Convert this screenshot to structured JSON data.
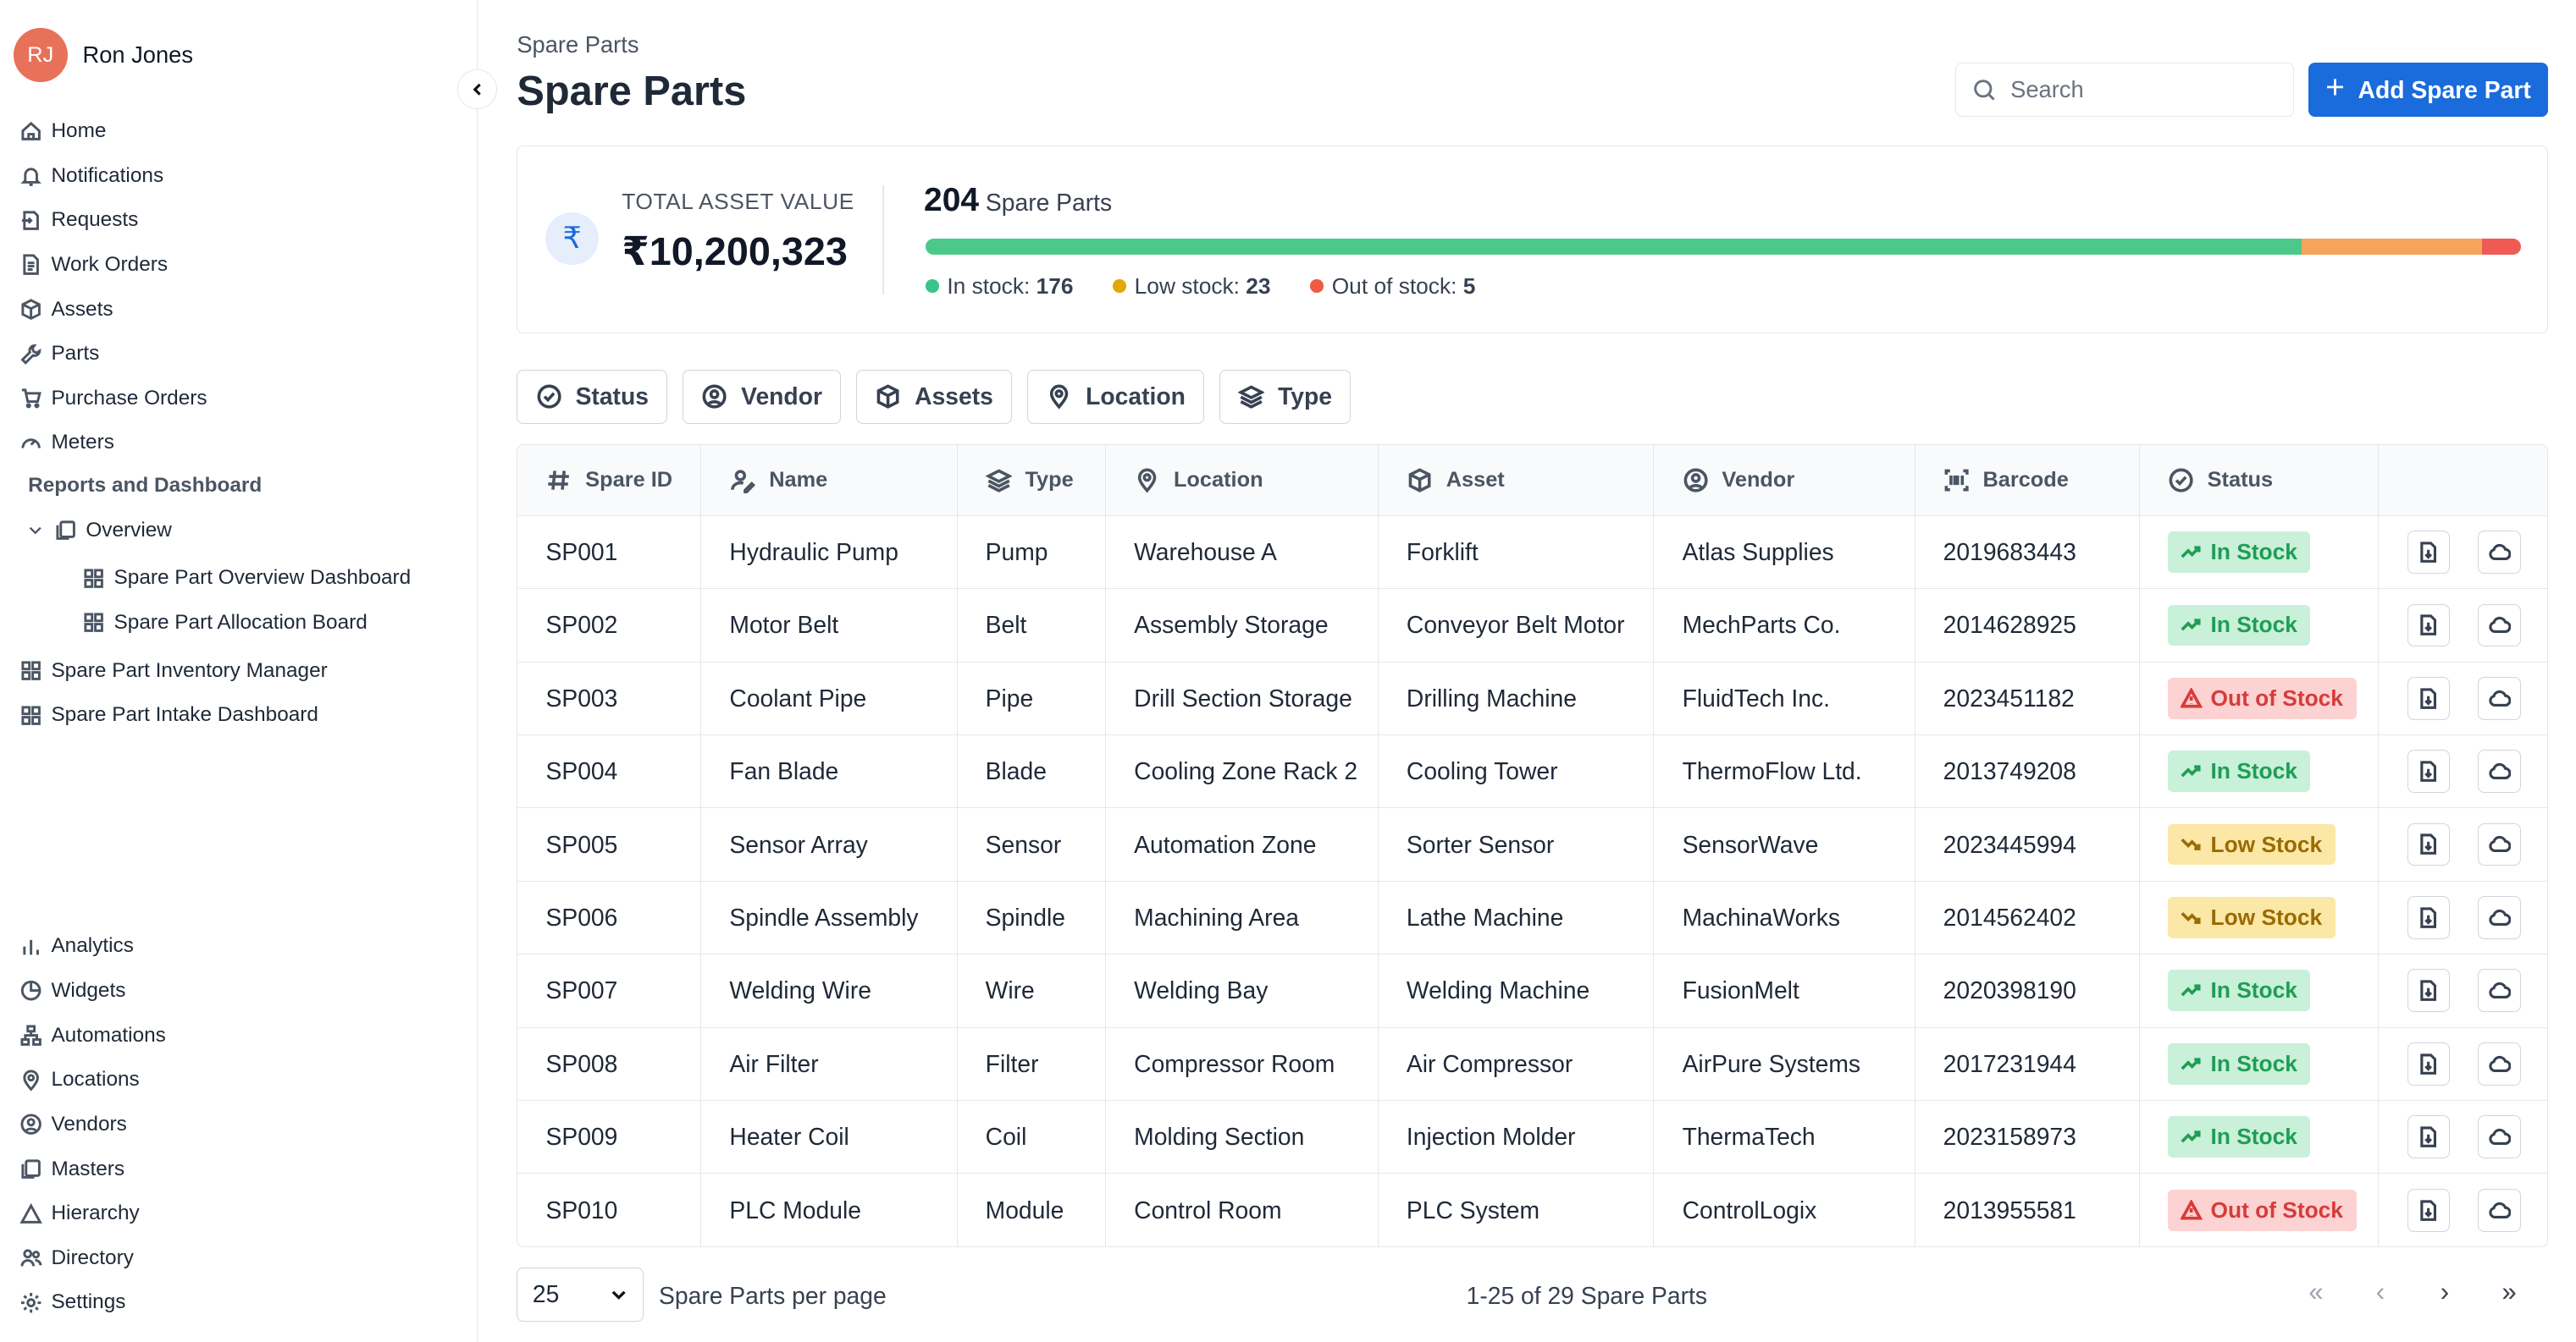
{
  "user": {
    "initials": "RJ",
    "name": "Ron Jones"
  },
  "nav": {
    "primary": [
      {
        "label": "Home",
        "icon": "home-icon"
      },
      {
        "label": "Notifications",
        "icon": "bell-icon"
      },
      {
        "label": "Requests",
        "icon": "request-icon"
      },
      {
        "label": "Work Orders",
        "icon": "document-icon"
      },
      {
        "label": "Assets",
        "icon": "cube-icon"
      },
      {
        "label": "Parts",
        "icon": "wrench-icon"
      },
      {
        "label": "Purchase Orders",
        "icon": "cart-icon"
      },
      {
        "label": "Meters",
        "icon": "gauge-icon"
      }
    ],
    "reports_title": "Reports and Dashboard",
    "overview": "Overview",
    "overview_children": [
      "Spare Part Overview Dashboard",
      "Spare Part Allocation Board"
    ],
    "dashboards": [
      "Spare Part Inventory Manager",
      "Spare Part Intake Dashboard"
    ],
    "secondary": [
      {
        "label": "Analytics",
        "icon": "bar-chart-icon"
      },
      {
        "label": "Widgets",
        "icon": "pie-icon"
      },
      {
        "label": "Automations",
        "icon": "flow-icon"
      },
      {
        "label": "Locations",
        "icon": "location-icon"
      },
      {
        "label": "Vendors",
        "icon": "user-circle-icon"
      },
      {
        "label": "Masters",
        "icon": "copy-icon"
      },
      {
        "label": "Hierarchy",
        "icon": "triangle-icon"
      },
      {
        "label": "Directory",
        "icon": "users-icon"
      },
      {
        "label": "Settings",
        "icon": "gear-icon"
      }
    ]
  },
  "header": {
    "breadcrumb": "Spare Parts",
    "title": "Spare Parts",
    "search_placeholder": "Search",
    "add_button": "Add Spare Part"
  },
  "summary": {
    "currency_symbol": "₹",
    "total_label": "TOTAL ASSET VALUE",
    "total_value": "₹10,200,323",
    "count": "204",
    "count_label": "Spare Parts",
    "in_stock_label": "In stock:",
    "in_stock": 176,
    "low_stock_label": "Low stock:",
    "low_stock": 23,
    "out_stock_label": "Out of stock:",
    "out_stock": 5,
    "colors": {
      "in": "#4cc98a",
      "low": "#f6a35c",
      "out": "#ef5a55",
      "in_dot": "#3cc48a",
      "low_dot": "#e0a800",
      "out_dot": "#ef5a44"
    }
  },
  "filters": [
    {
      "label": "Status",
      "icon": "check-circle-icon"
    },
    {
      "label": "Vendor",
      "icon": "user-circle-icon"
    },
    {
      "label": "Assets",
      "icon": "cube-icon"
    },
    {
      "label": "Location",
      "icon": "location-icon"
    },
    {
      "label": "Type",
      "icon": "layers-icon"
    }
  ],
  "table": {
    "columns": [
      {
        "label": "Spare ID",
        "icon": "hash-icon"
      },
      {
        "label": "Name",
        "icon": "user-edit-icon"
      },
      {
        "label": "Type",
        "icon": "layers-icon"
      },
      {
        "label": "Location",
        "icon": "location-icon"
      },
      {
        "label": "Asset",
        "icon": "cube-icon"
      },
      {
        "label": "Vendor",
        "icon": "user-circle-icon"
      },
      {
        "label": "Barcode",
        "icon": "barcode-icon"
      },
      {
        "label": "Status",
        "icon": "check-circle-icon"
      }
    ],
    "rows": [
      {
        "id": "SP001",
        "name": "Hydraulic Pump",
        "type": "Pump",
        "location": "Warehouse A",
        "asset": "Forklift",
        "vendor": "Atlas Supplies",
        "barcode": "2019683443",
        "status": "In Stock",
        "kind": "in"
      },
      {
        "id": "SP002",
        "name": "Motor Belt",
        "type": "Belt",
        "location": "Assembly Storage",
        "asset": "Conveyor Belt Motor",
        "vendor": "MechParts Co.",
        "barcode": "2014628925",
        "status": "In Stock",
        "kind": "in"
      },
      {
        "id": "SP003",
        "name": "Coolant Pipe",
        "type": "Pipe",
        "location": "Drill Section Storage",
        "asset": "Drilling Machine",
        "vendor": "FluidTech Inc.",
        "barcode": "2023451182",
        "status": "Out of Stock",
        "kind": "out"
      },
      {
        "id": "SP004",
        "name": "Fan Blade",
        "type": "Blade",
        "location": "Cooling Zone Rack 2",
        "asset": "Cooling Tower",
        "vendor": "ThermoFlow Ltd.",
        "barcode": "2013749208",
        "status": "In Stock",
        "kind": "in"
      },
      {
        "id": "SP005",
        "name": "Sensor Array",
        "type": "Sensor",
        "location": "Automation Zone",
        "asset": "Sorter Sensor",
        "vendor": "SensorWave",
        "barcode": "2023445994",
        "status": "Low Stock",
        "kind": "low"
      },
      {
        "id": "SP006",
        "name": "Spindle Assembly",
        "type": "Spindle",
        "location": "Machining Area",
        "asset": "Lathe Machine",
        "vendor": "MachinaWorks",
        "barcode": "2014562402",
        "status": "Low Stock",
        "kind": "low"
      },
      {
        "id": "SP007",
        "name": "Welding Wire",
        "type": "Wire",
        "location": "Welding Bay",
        "asset": "Welding Machine",
        "vendor": "FusionMelt",
        "barcode": "2020398190",
        "status": "In Stock",
        "kind": "in"
      },
      {
        "id": "SP008",
        "name": "Air Filter",
        "type": "Filter",
        "location": "Compressor Room",
        "asset": "Air Compressor",
        "vendor": "AirPure Systems",
        "barcode": "2017231944",
        "status": "In Stock",
        "kind": "in"
      },
      {
        "id": "SP009",
        "name": "Heater Coil",
        "type": "Coil",
        "location": "Molding Section",
        "asset": "Injection Molder",
        "vendor": "ThermaTech",
        "barcode": "2023158973",
        "status": "In Stock",
        "kind": "in"
      },
      {
        "id": "SP010",
        "name": "PLC Module",
        "type": "Module",
        "location": "Control Room",
        "asset": "PLC System",
        "vendor": "ControlLogix",
        "barcode": "2013955581",
        "status": "Out of Stock",
        "kind": "out"
      }
    ]
  },
  "pagination": {
    "per_page": "25",
    "per_page_label": "Spare Parts per page",
    "range": "1-25 of 29 Spare Parts",
    "first": "«",
    "prev": "‹",
    "next": "›",
    "last": "»"
  }
}
